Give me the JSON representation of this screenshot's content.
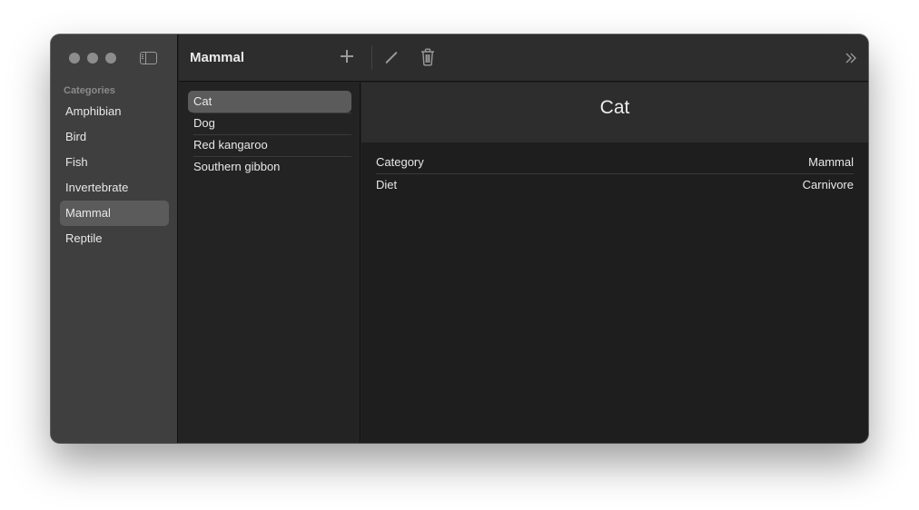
{
  "toolbar": {
    "title": "Mammal"
  },
  "sidebar": {
    "section_label": "Categories",
    "items": [
      {
        "label": "Amphibian",
        "selected": false
      },
      {
        "label": "Bird",
        "selected": false
      },
      {
        "label": "Fish",
        "selected": false
      },
      {
        "label": "Invertebrate",
        "selected": false
      },
      {
        "label": "Mammal",
        "selected": true
      },
      {
        "label": "Reptile",
        "selected": false
      }
    ]
  },
  "list": {
    "items": [
      {
        "label": "Cat",
        "selected": true
      },
      {
        "label": "Dog",
        "selected": false
      },
      {
        "label": "Red kangaroo",
        "selected": false
      },
      {
        "label": "Southern gibbon",
        "selected": false
      }
    ]
  },
  "detail": {
    "title": "Cat",
    "properties": [
      {
        "label": "Category",
        "value": "Mammal"
      },
      {
        "label": "Diet",
        "value": "Carnivore"
      }
    ]
  },
  "icons": {
    "window_controls": [
      "close-dot",
      "minimize-dot",
      "zoom-dot"
    ],
    "sidebar_toggle": "sidebar-toggle-icon",
    "add": "plus-icon",
    "edit": "pencil-icon",
    "delete": "trash-icon",
    "overflow": "chevrons-right-icon"
  },
  "colors": {
    "sidebar_bg": "#3f3f3f",
    "content_bg": "#232323",
    "selection": "#5b5b5b",
    "control_dot": "#8d8d8d"
  }
}
